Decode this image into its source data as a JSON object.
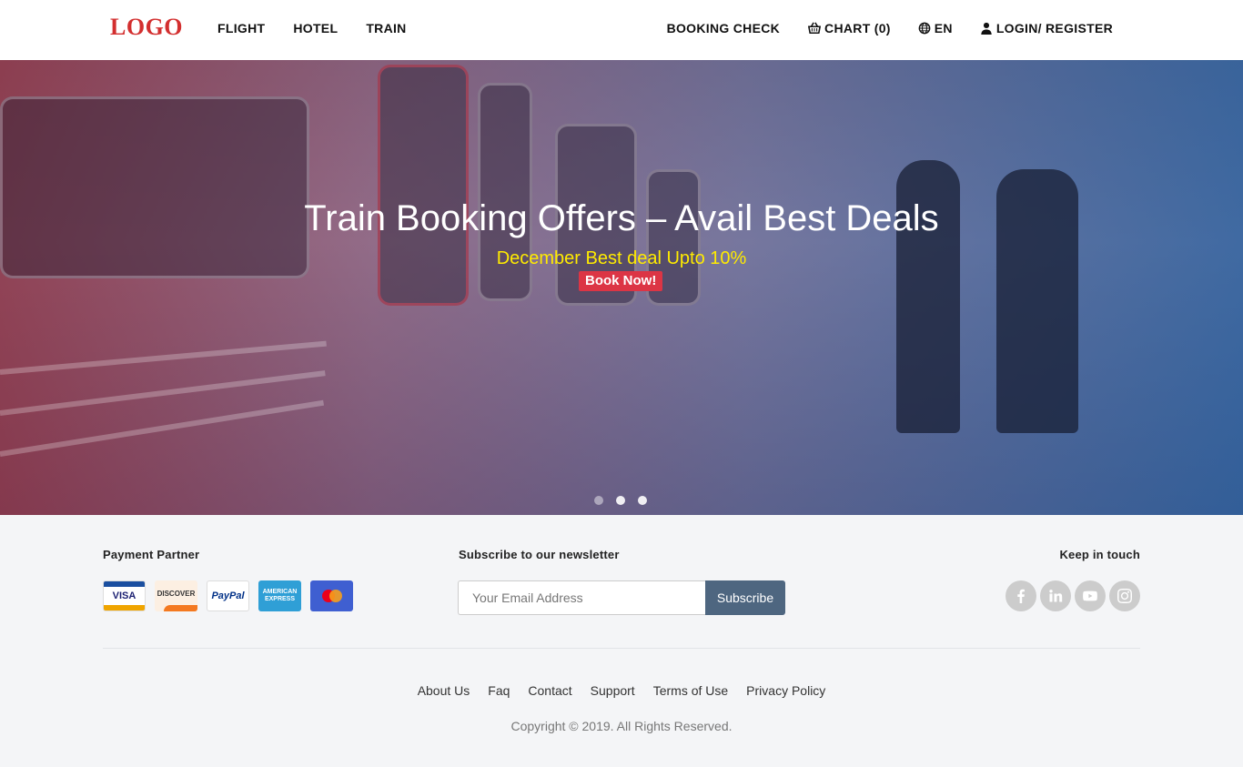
{
  "header": {
    "logo": "LOGO",
    "nav_left": [
      "FLIGHT",
      "HOTEL",
      "TRAIN"
    ],
    "booking_check": "BOOKING CHECK",
    "chart": "CHART (0)",
    "language": "EN",
    "login": "LOGIN/ REGISTER"
  },
  "hero": {
    "title": "Train Booking Offers – Avail Best Deals",
    "subtitle": "December Best deal Upto 10%",
    "button": "Book Now!",
    "slides_total": 3,
    "active_slide": 2
  },
  "footer": {
    "payment_heading": "Payment Partner",
    "payment_cards": {
      "visa": "VISA",
      "discover": "DISCOVER",
      "paypal": "PayPal",
      "amex": "AMERICAN EXPRESS",
      "mastercard_icon": "mastercard-logo"
    },
    "newsletter_heading": "Subscribe to our newsletter",
    "email_placeholder": "Your Email Address",
    "subscribe_label": "Subscribe",
    "social_heading": "Keep in touch",
    "social_icons": [
      "facebook-icon",
      "linkedin-icon",
      "youtube-icon",
      "instagram-icon"
    ],
    "links": [
      "About Us",
      "Faq",
      "Contact",
      "Support",
      "Terms of Use",
      "Privacy Policy"
    ],
    "copyright": "Copyright © 2019. All Rights Reserved."
  },
  "colors": {
    "logo": "#d32f2f",
    "hero_subtitle": "#ffeb00",
    "book_button": "#dc3545",
    "subscribe_button": "#4e6680",
    "footer_bg": "#f4f5f7"
  }
}
